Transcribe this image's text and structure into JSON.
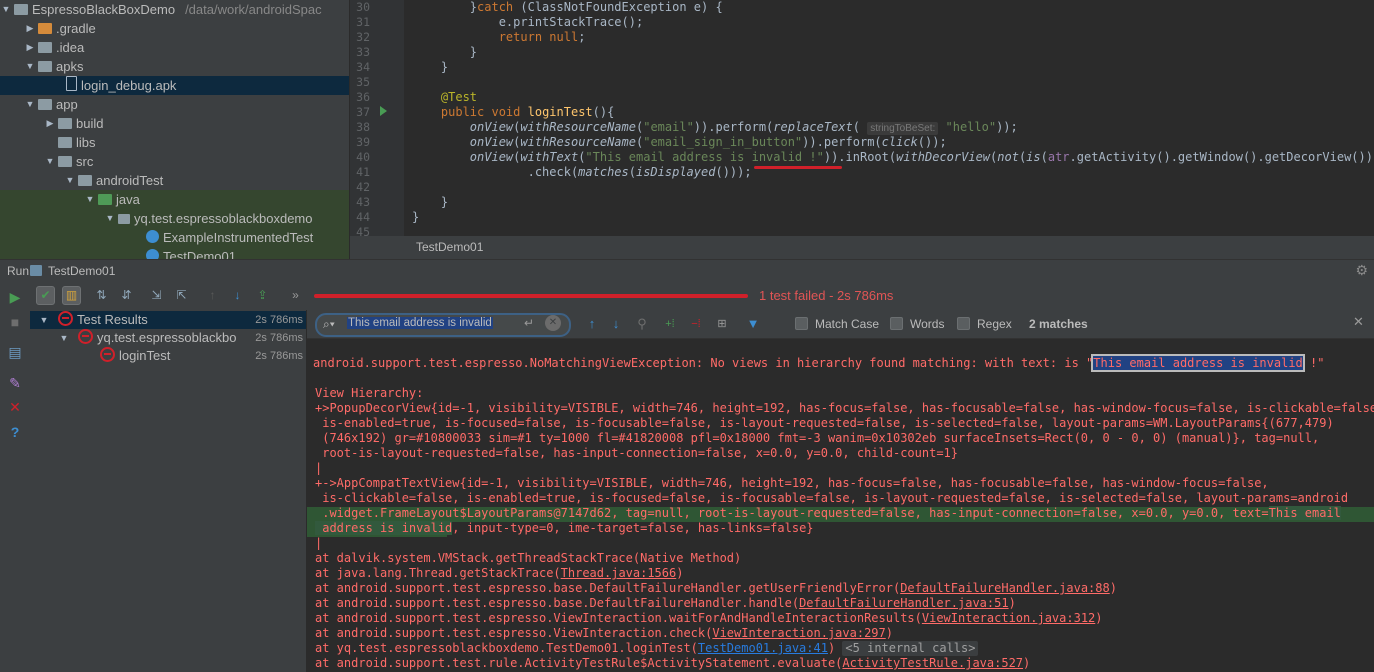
{
  "project": {
    "root_name": "EspressoBlackBoxDemo",
    "root_path": "/data/work/androidSpac",
    "items": [
      {
        "label": "EspressoBlackBoxDemo"
      },
      {
        "label": ".gradle"
      },
      {
        "label": ".idea"
      },
      {
        "label": "apks"
      },
      {
        "label": "login_debug.apk"
      },
      {
        "label": "app"
      },
      {
        "label": "build"
      },
      {
        "label": "libs"
      },
      {
        "label": "src"
      },
      {
        "label": "androidTest"
      },
      {
        "label": "java"
      },
      {
        "label": "yq.test.espressoblackboxdemo"
      },
      {
        "label": "ExampleInstrumentedTest"
      },
      {
        "label": "TestDemo01"
      }
    ]
  },
  "editor": {
    "line_numbers": [
      "30",
      "31",
      "32",
      "33",
      "34",
      "35",
      "36",
      "37",
      "38",
      "39",
      "40",
      "41",
      "42",
      "43",
      "44",
      "45"
    ],
    "param_hint": "stringToBeSet:",
    "tab_label": "TestDemo01"
  },
  "run": {
    "panel_label": "Run",
    "config_name": "TestDemo01",
    "status_text": "1 test failed - 2s 786ms",
    "results": [
      {
        "label": "Test Results",
        "time": "2s 786ms"
      },
      {
        "label": "yq.test.espressoblackbo",
        "time": "2s 786ms"
      },
      {
        "label": "loginTest",
        "time": "2s 786ms"
      }
    ]
  },
  "search": {
    "query": "This email address is invalid",
    "match_case_label": "Match Case",
    "words_label": "Words",
    "regex_label": "Regex",
    "matches_text": "2 matches"
  },
  "console": {
    "exception_prefix": "android.support.test.espresso.NoMatchingViewException: No views in hierarchy found matching: with text: is \"",
    "exception_match": "This email address is invalid",
    "exception_suffix": " !\"",
    "view_hierarchy_label": "View Hierarchy:",
    "popup_1": "+>PopupDecorView{id=-1, visibility=VISIBLE, width=746, height=192, has-focus=false, has-focusable=false, has-window-focus=false, is-clickable=false,",
    "popup_2": " is-enabled=true, is-focused=false, is-focusable=false, is-layout-requested=false, is-selected=false, layout-params=WM.LayoutParams{(677,479)",
    "popup_3": " (746x192) gr=#10800033 sim=#1 ty=1000 fl=#41820008 pfl=0x18000 fmt=-3 wanim=0x10302eb surfaceInsets=Rect(0, 0 - 0, 0) (manual)}, tag=null,",
    "popup_4": " root-is-layout-requested=false, has-input-connection=false, x=0.0, y=0.0, child-count=1}",
    "pipe": "|",
    "compat_1": "+->AppCompatTextView{id=-1, visibility=VISIBLE, width=746, height=192, has-focus=false, has-focusable=false, has-window-focus=false,",
    "compat_2": " is-clickable=false, is-enabled=true, is-focused=false, is-focusable=false, is-layout-requested=false, is-selected=false, layout-params=android",
    "compat_3_prefix": " .widget.FrameLayout$LayoutParams@7147d62, tag=null, root-is-layout-requested=false, has-input-connection=false, x=0.0, y=0.0, text=",
    "compat_3_match": "This email",
    "compat_4_match": " address is invalid",
    "compat_4_suffix": ", input-type=0, ime-target=false, has-links=false}",
    "st1_pre": "at dalvik.system.VMStack.getThreadStackTrace(Native Method)",
    "st2_pre": "at java.lang.Thread.getStackTrace(",
    "st2_link": "Thread.java:1566",
    "st3_pre": "at android.support.test.espresso.base.DefaultFailureHandler.getUserFriendlyError(",
    "st3_link": "DefaultFailureHandler.java:88",
    "st4_pre": "at android.support.test.espresso.base.DefaultFailureHandler.handle(",
    "st4_link": "DefaultFailureHandler.java:51",
    "st5_pre": "at android.support.test.espresso.ViewInteraction.waitForAndHandleInteractionResults(",
    "st5_link": "ViewInteraction.java:312",
    "st6_pre": "at android.support.test.espresso.ViewInteraction.check(",
    "st6_link": "ViewInteraction.java:297",
    "st7_pre": "at yq.test.espressoblackboxdemo.TestDemo01.loginTest(",
    "st7_link": "TestDemo01.java:41",
    "st7_fold": "<5 internal calls>",
    "st8_pre": "at android.support.test.rule.ActivityTestRule$ActivityStatement.evaluate(",
    "st8_link": "ActivityTestRule.java:527",
    "close_paren": ")"
  },
  "colors": {
    "error": "#ff6b68",
    "fail_bar": "#d0202a",
    "selection": "#0d293e",
    "match_highlight": "#32593d"
  }
}
